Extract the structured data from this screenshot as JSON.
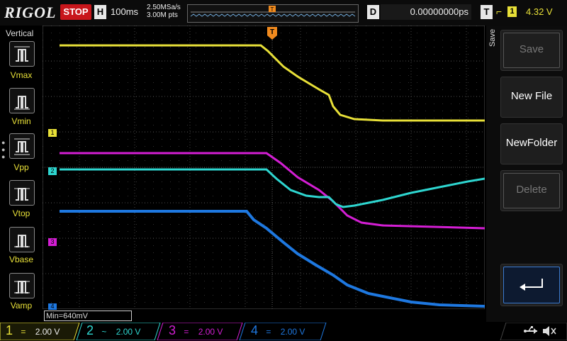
{
  "header": {
    "logo": "RIGOL",
    "run_state": "STOP",
    "horizontal_label": "H",
    "timebase": "100ms",
    "sample_rate": "2.50MSa/s",
    "memory_depth": "3.00M pts",
    "delay_label": "D",
    "delay_value": "0.00000000ps",
    "trigger_label": "T",
    "trigger_source": "1",
    "trigger_level": "4.32 V"
  },
  "measure_panel": {
    "title": "Vertical",
    "items": [
      {
        "label": "Vmax",
        "icon": "vmax-icon"
      },
      {
        "label": "Vmin",
        "icon": "vmin-icon"
      },
      {
        "label": "Vpp",
        "icon": "vpp-icon"
      },
      {
        "label": "Vtop",
        "icon": "vtop-icon"
      },
      {
        "label": "Vbase",
        "icon": "vbase-icon"
      },
      {
        "label": "Vamp",
        "icon": "vamp-icon"
      }
    ]
  },
  "save_menu": {
    "title": "Save",
    "buttons": [
      {
        "label": "Save",
        "enabled": false
      },
      {
        "label": "New File",
        "enabled": true
      },
      {
        "label": "NewFolder",
        "enabled": true
      },
      {
        "label": "Delete",
        "enabled": false
      }
    ],
    "enter_icon": "enter-arrow-icon"
  },
  "measurement_readout": "Min=640mV",
  "channels": [
    {
      "number": "1",
      "coupling": "=",
      "scale": "2.00 V",
      "color": "#e8e038"
    },
    {
      "number": "2",
      "coupling": "~",
      "scale": "2.00 V",
      "color": "#2ed6d0"
    },
    {
      "number": "3",
      "coupling": "=",
      "scale": "2.00 V",
      "color": "#d41ed4"
    },
    {
      "number": "4",
      "coupling": "=",
      "scale": "2.00 V",
      "color": "#1e78e0"
    }
  ],
  "ground_markers": [
    "1",
    "2",
    "3",
    "4"
  ],
  "status_icons": [
    "usb-icon",
    "speaker-muted-icon"
  ],
  "colors": {
    "ch1": "#e8e038",
    "ch2": "#2ed6d0",
    "ch3": "#d41ed4",
    "ch4": "#1e78e0",
    "stop": "#c8161b",
    "trigger_marker": "#f08a1e"
  }
}
